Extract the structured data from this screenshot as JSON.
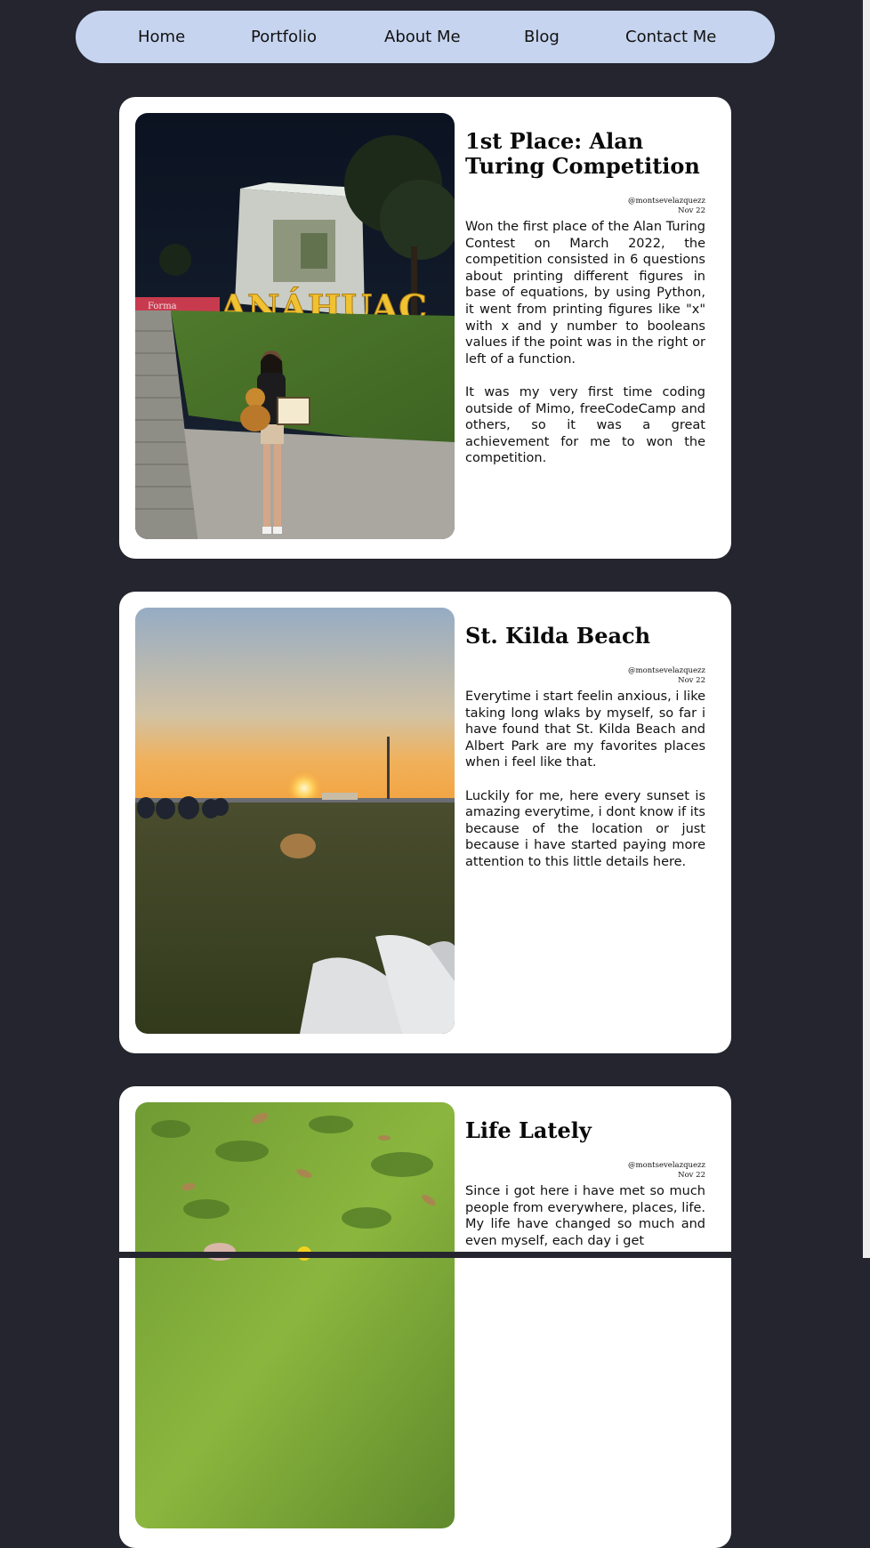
{
  "nav": {
    "items": [
      {
        "label": "Home"
      },
      {
        "label": "Portfolio"
      },
      {
        "label": "About Me"
      },
      {
        "label": "Blog"
      },
      {
        "label": "Contact Me"
      }
    ]
  },
  "posts": [
    {
      "title": "1st Place: Alan Turing Competition",
      "author": "@montsevelazquezz",
      "date": "Nov 22",
      "paragraphs": [
        "Won the first place of the Alan Turing Contest on March 2022, the competition consisted in 6 questions about printing different figures in base of equations, by using Python, it went from printing figures like \"x\" with x and y number to booleans values if the point was in the right or left of a function.",
        "It was my very first time coding outside of Mimo, freeCodeCamp and others, so it was a great achievement for me to won the competition."
      ],
      "photo_sign": "ANÁHUAC",
      "photo_banner": "Forma"
    },
    {
      "title": "St. Kilda Beach",
      "author": "@montsevelazquezz",
      "date": "Nov 22",
      "paragraphs": [
        "Everytime i start feelin anxious, i like taking long wlaks by myself, so far i have found that St. Kilda Beach and Albert Park are my favorites places when i feel like that.",
        "Luckily for me, here every sunset is amazing everytime, i dont know if its because of the location or just because i have started paying more attention to this little details here."
      ]
    },
    {
      "title": "Life Lately",
      "author": "@montsevelazquezz",
      "date": "Nov 22",
      "paragraphs": [
        "Since i got here i have met so much people from everywhere, places, life. My life have changed so much and even myself, each day i get"
      ]
    }
  ],
  "colors": {
    "page_background": "#25252f",
    "nav_background": "#c6d4ef",
    "card_background": "#ffffff"
  }
}
